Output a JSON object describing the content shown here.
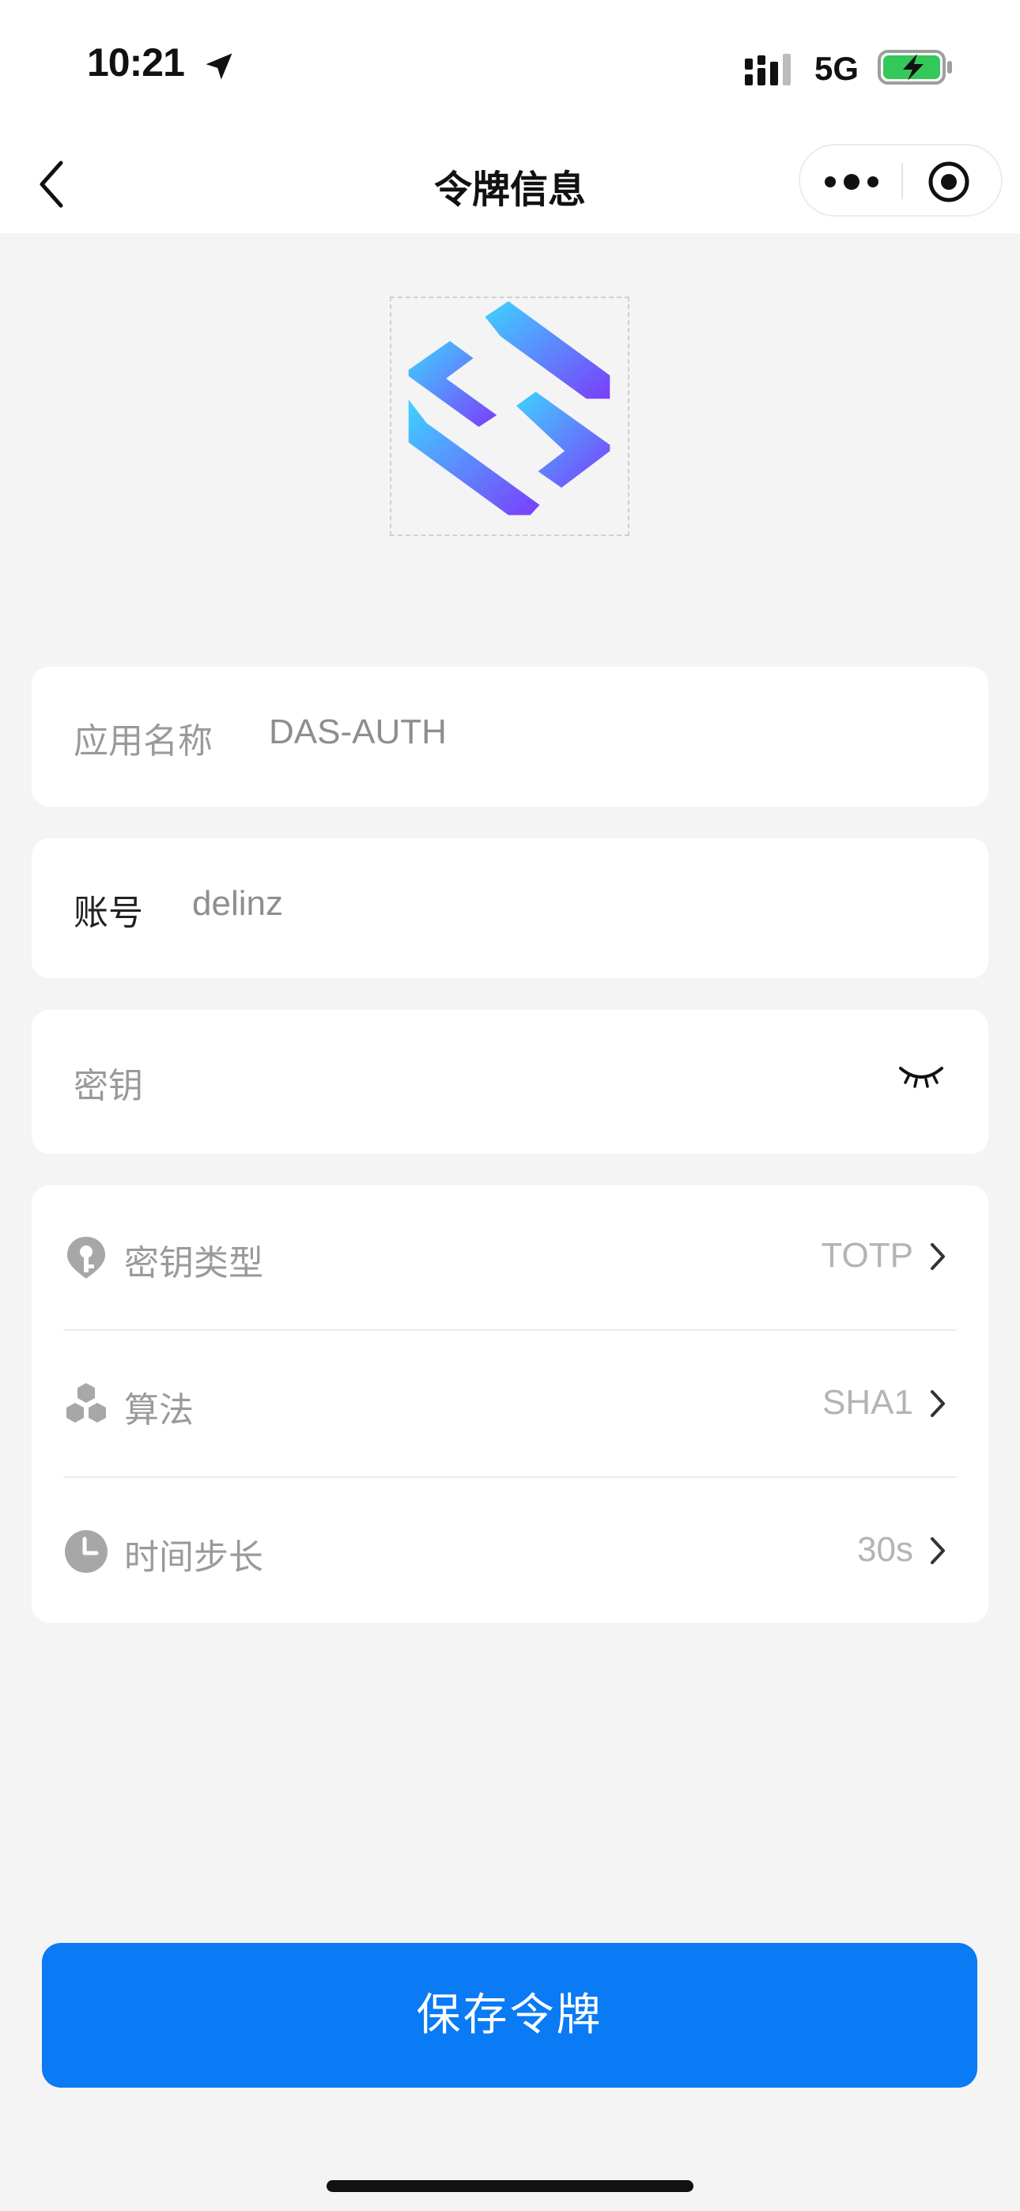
{
  "status_bar": {
    "time": "10:21",
    "network": "5G"
  },
  "nav": {
    "title": "令牌信息",
    "back_icon": "chevron-left-icon",
    "more_icon": "more-dots-icon",
    "close_icon": "target-icon"
  },
  "form": {
    "app_name": {
      "label": "应用名称",
      "value": "DAS-AUTH"
    },
    "account": {
      "label": "账号",
      "value": "delinz"
    },
    "secret": {
      "label": "密钥",
      "value": "",
      "toggle_icon": "eye-closed-icon"
    },
    "settings": [
      {
        "label": "密钥类型",
        "value": "TOTP",
        "icon": "key-pin-icon"
      },
      {
        "label": "算法",
        "value": "SHA1",
        "icon": "hexagons-icon"
      },
      {
        "label": "时间步长",
        "value": "30s",
        "icon": "clock-icon"
      }
    ]
  },
  "actions": {
    "save_label": "保存令牌"
  },
  "colors": {
    "primary": "#0a7af5",
    "background": "#f4f4f4",
    "battery": "#34c759",
    "logo_start": "#3ed3ff",
    "logo_end": "#7b3dfb"
  }
}
